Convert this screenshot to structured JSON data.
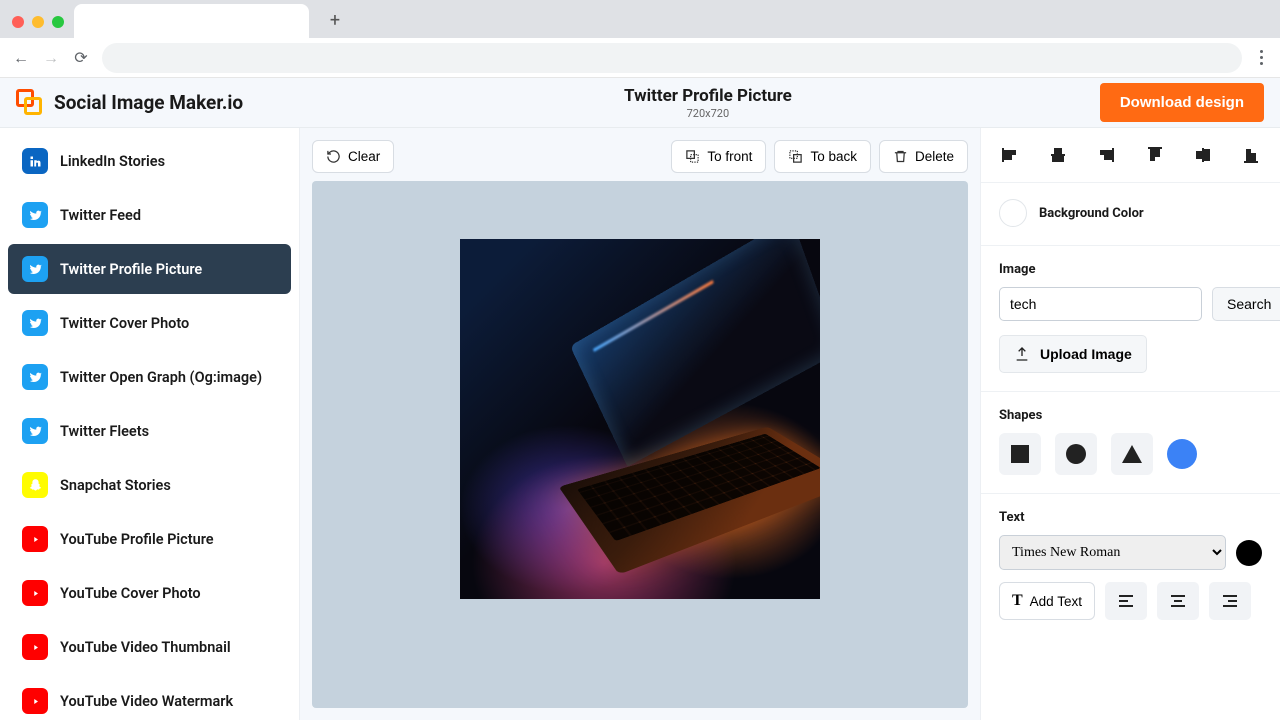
{
  "app": {
    "brand": "Social Image Maker.io",
    "download_label": "Download design"
  },
  "header": {
    "title": "Twitter Profile Picture",
    "dimensions": "720x720"
  },
  "sidebar": {
    "items": [
      {
        "platform": "linkedin",
        "label": "LinkedIn Stories",
        "active": false
      },
      {
        "platform": "twitter",
        "label": "Twitter Feed",
        "active": false
      },
      {
        "platform": "twitter",
        "label": "Twitter Profile Picture",
        "active": true
      },
      {
        "platform": "twitter",
        "label": "Twitter Cover Photo",
        "active": false
      },
      {
        "platform": "twitter",
        "label": "Twitter Open Graph (Og:image)",
        "active": false
      },
      {
        "platform": "twitter",
        "label": "Twitter Fleets",
        "active": false
      },
      {
        "platform": "snapchat",
        "label": "Snapchat Stories",
        "active": false
      },
      {
        "platform": "youtube",
        "label": "YouTube Profile Picture",
        "active": false
      },
      {
        "platform": "youtube",
        "label": "YouTube Cover Photo",
        "active": false
      },
      {
        "platform": "youtube",
        "label": "YouTube Video Thumbnail",
        "active": false
      },
      {
        "platform": "youtube",
        "label": "YouTube Video Watermark",
        "active": false
      }
    ]
  },
  "canvas_toolbar": {
    "clear": "Clear",
    "to_front": "To front",
    "to_back": "To back",
    "delete": "Delete"
  },
  "panel": {
    "bg_label": "Background Color",
    "image_label": "Image",
    "image_search_value": "tech",
    "search_btn": "Search",
    "upload_label": "Upload Image",
    "shapes_label": "Shapes",
    "text_label": "Text",
    "font_value": "Times New Roman",
    "add_text_label": "Add Text"
  }
}
